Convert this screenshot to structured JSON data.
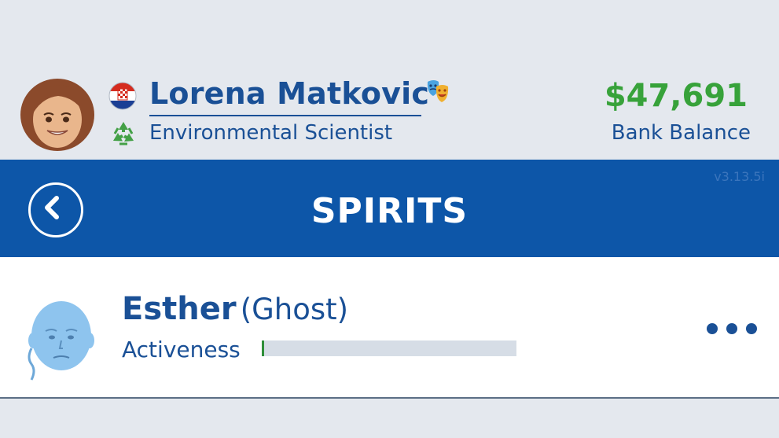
{
  "profile": {
    "name": "Lorena Matkovic",
    "occupation": "Environmental Scientist",
    "bank_amount": "$47,691",
    "bank_label": "Bank Balance",
    "flag_icon": "croatia-flag-icon",
    "badge_icon": "theater-masks-icon",
    "occupation_icon": "recycle-icon"
  },
  "nav": {
    "title": "SPIRITS",
    "version": "v3.13.5i",
    "back_icon": "chevron-left-icon"
  },
  "spirits": [
    {
      "name": "Esther",
      "type": "(Ghost)",
      "stat_label": "Activeness",
      "activeness": 0.01,
      "more_icon": "ellipsis-icon"
    }
  ],
  "colors": {
    "brand_blue": "#0d56a8",
    "text_blue": "#1a5096",
    "money_green": "#37a23a",
    "background": "#e4e8ee"
  }
}
